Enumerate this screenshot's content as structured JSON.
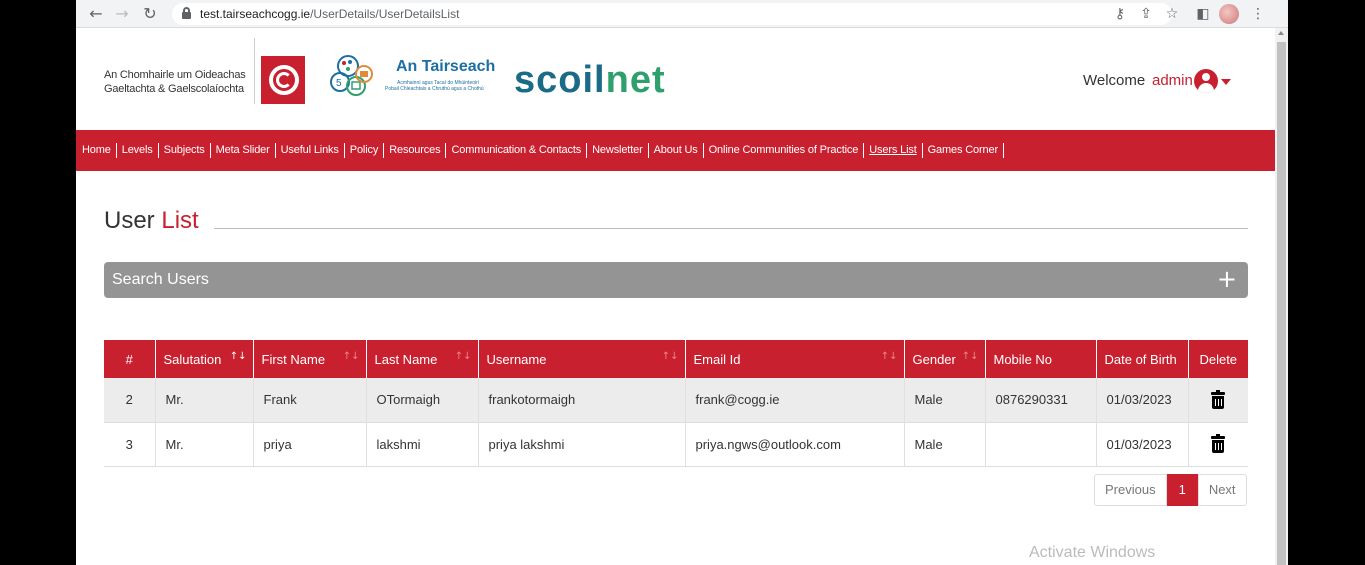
{
  "browser": {
    "url_host": "test.tairseachcogg.ie",
    "url_path": "/UserDetails/UserDetailsList"
  },
  "header": {
    "org_line1": "An Chomhairle um Oideachas",
    "org_line2": "Gaeltachta & Gaelscolaíochta",
    "tairseach_title": "An Tairseach",
    "tairseach_sub1": "Acmhainní agus Tacaí do Mhúinteoirí",
    "tairseach_sub2": "Pobail Chleachtais a Chruthú agus a Chothú",
    "scoilnet_a": "scoil",
    "scoilnet_b": "net",
    "welcome": "Welcome",
    "user": "admin",
    "brand_color": "#c8202f"
  },
  "nav": {
    "items": [
      {
        "label": "Home"
      },
      {
        "label": "Levels"
      },
      {
        "label": "Subjects"
      },
      {
        "label": "Meta Slider"
      },
      {
        "label": "Useful Links"
      },
      {
        "label": "Policy"
      },
      {
        "label": "Resources"
      },
      {
        "label": "Communication & Contacts"
      },
      {
        "label": "Newsletter"
      },
      {
        "label": "About Us"
      },
      {
        "label": "Online Communities of Practice"
      },
      {
        "label": "Users List"
      },
      {
        "label": "Games Corner"
      }
    ],
    "active": "Users List"
  },
  "page": {
    "title_a": "User",
    "title_b": "List",
    "search_label": "Search Users",
    "search_toggle": "+"
  },
  "table": {
    "columns": [
      "#",
      "Salutation",
      "First Name",
      "Last Name",
      "Username",
      "Email Id",
      "Gender",
      "Mobile No",
      "Date of Birth",
      "Delete"
    ],
    "rows": [
      {
        "num": "2",
        "salutation": "Mr.",
        "first": "Frank",
        "last": "OTormaigh",
        "username": "frankotormaigh",
        "email": "frank@cogg.ie",
        "gender": "Male",
        "mobile": "0876290331",
        "dob": "01/03/2023"
      },
      {
        "num": "3",
        "salutation": "Mr.",
        "first": "priya",
        "last": "lakshmi",
        "username": "priya lakshmi",
        "email": "priya.ngws@outlook.com",
        "gender": "Male",
        "mobile": "",
        "dob": "01/03/2023"
      }
    ]
  },
  "pagination": {
    "previous": "Previous",
    "current": "1",
    "next": "Next"
  },
  "watermark": "Activate Windows"
}
